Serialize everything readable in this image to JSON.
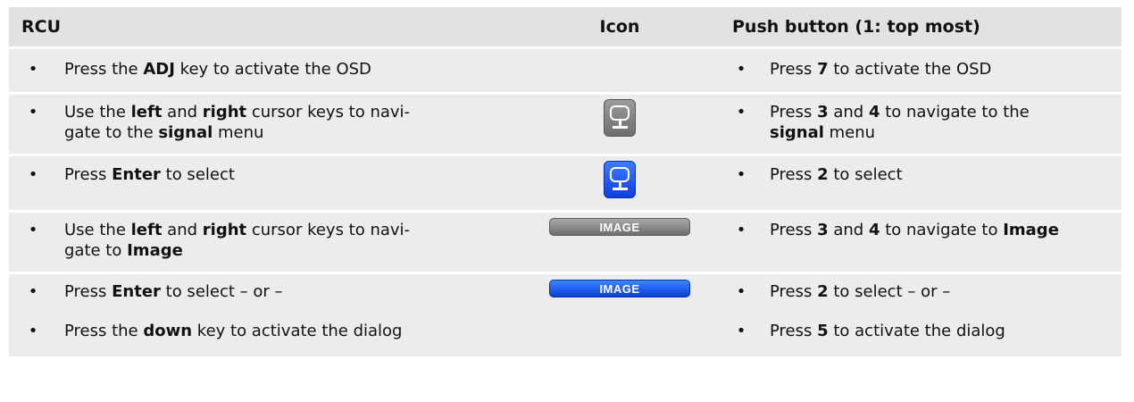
{
  "header": {
    "rcu": "RCU",
    "icon": "Icon",
    "push": "Push button (1: top most)"
  },
  "rows": [
    {
      "rcu": [
        [
          "Press the ",
          "ADJ",
          " key to activate the OSD"
        ]
      ],
      "push": [
        [
          "Press ",
          "7",
          " to activate the OSD"
        ]
      ]
    },
    {
      "icon": "monitor-icon-gray",
      "rcu": [
        [
          "Use the ",
          "left",
          " and ",
          "right",
          " cursor keys to navi-",
          "gate to the ",
          "signal",
          " menu"
        ]
      ],
      "push": [
        [
          "Press ",
          "3",
          " and ",
          "4",
          " to navigate to the ",
          "signal",
          " menu"
        ]
      ]
    },
    {
      "icon": "monitor-icon-blue",
      "rcu": [
        [
          "Press ",
          "Enter",
          " to select"
        ]
      ],
      "push": [
        [
          "Press ",
          "2",
          " to select"
        ]
      ]
    },
    {
      "icon": "image-button-gray",
      "icon_label": "IMAGE",
      "rcu": [
        [
          "Use the ",
          "left",
          " and ",
          "right",
          " cursor keys to navi-",
          "gate to ",
          "Image"
        ]
      ],
      "push": [
        [
          "Press ",
          "3",
          " and ",
          "4",
          " to navigate to ",
          "Image"
        ]
      ]
    },
    {
      "icon": "image-button-blue",
      "icon_label": "IMAGE",
      "rcu": [
        [
          "Press ",
          "Enter",
          " to select – or –"
        ],
        [
          "Press the ",
          "down",
          " key to activate the dialog"
        ]
      ],
      "push": [
        [
          "Press ",
          "2",
          " to select – or –"
        ],
        [
          "Press ",
          "5",
          " to activate the dialog"
        ]
      ]
    }
  ],
  "colors": {
    "row_bg": "#ececec",
    "header_bg": "#e2e2e2",
    "icon_blue": "#1f5cf5",
    "icon_gray": "#8a8a8a"
  }
}
